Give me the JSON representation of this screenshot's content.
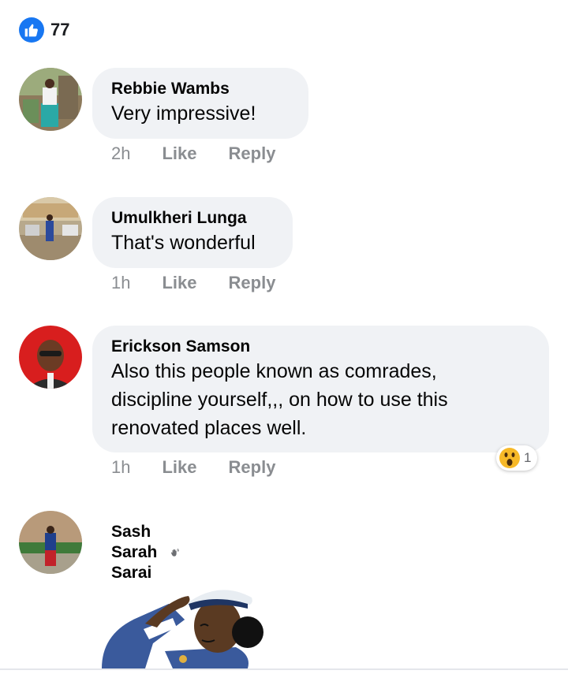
{
  "reactions": {
    "count": "77",
    "icon": "thumbs-up-icon",
    "color": "#1877f2"
  },
  "comments": [
    {
      "author": "Rebbie Wambs",
      "text": "Very impressive!",
      "time": "2h",
      "like": "Like",
      "reply": "Reply"
    },
    {
      "author": "Umulkheri Lunga",
      "text": "That's wonderful",
      "time": "1h",
      "like": "Like",
      "reply": "Reply"
    },
    {
      "author": "Erickson Samson",
      "text_lines": [
        "Also this people known as comrades,",
        "discipline yourself,,, on how to use this",
        "renovated places well."
      ],
      "time": "1h",
      "like": "Like",
      "reply": "Reply",
      "reaction": {
        "icon": "wow-emoji-icon",
        "count": "1"
      }
    },
    {
      "author": "Sash Sarah Sarai",
      "author_emoji": "waving-hand-icon",
      "sticker": "saluting-sailor-sticker"
    }
  ]
}
